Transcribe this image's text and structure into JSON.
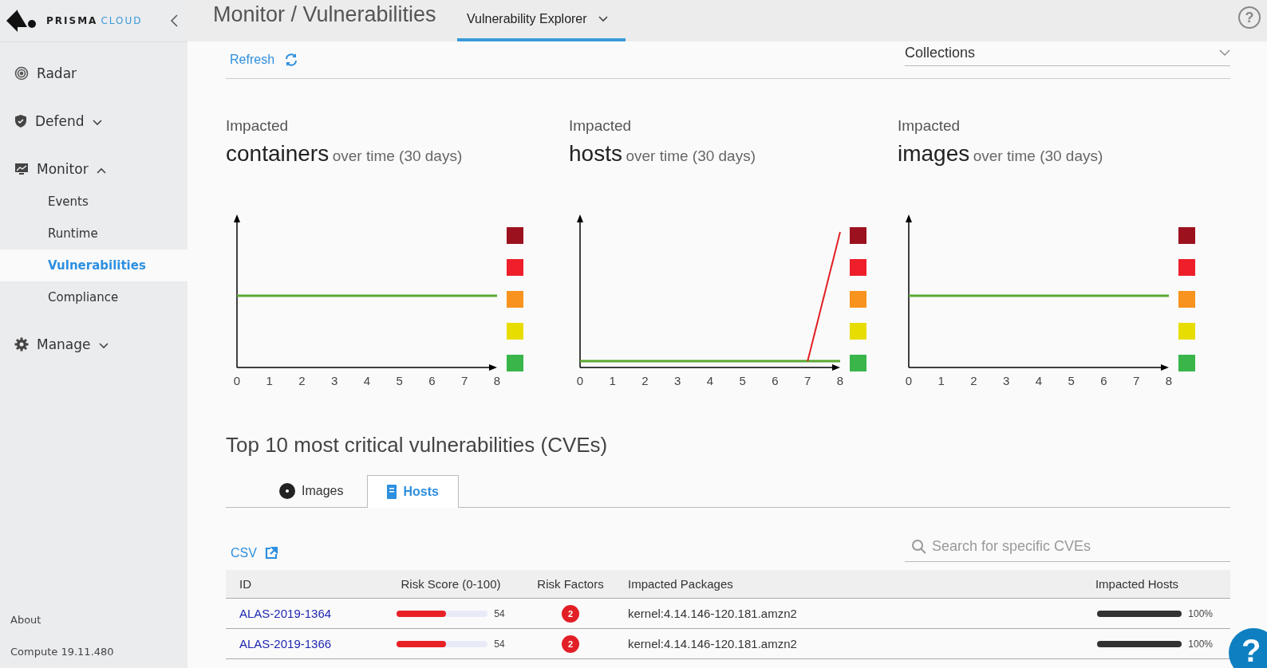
{
  "sidebar": {
    "logo": {
      "brand": "PRISMA",
      "product": "CLOUD"
    },
    "items": [
      {
        "label": "Radar",
        "kind": "radar"
      },
      {
        "label": "Defend",
        "kind": "shield",
        "expanded": false
      },
      {
        "label": "Monitor",
        "kind": "monitor",
        "expanded": true,
        "children": [
          {
            "label": "Events",
            "selected": false
          },
          {
            "label": "Runtime",
            "selected": false
          },
          {
            "label": "Vulnerabilities",
            "selected": true
          },
          {
            "label": "Compliance",
            "selected": false
          }
        ]
      },
      {
        "label": "Manage",
        "kind": "gear",
        "expanded": false
      }
    ],
    "footer": [
      "About",
      "Compute 19.11.480"
    ]
  },
  "header": {
    "title": "Monitor / Vulnerabilities",
    "tabs": [
      {
        "label": "Vulnerability Explorer",
        "selected": true
      }
    ]
  },
  "toolbar": {
    "refresh": "Refresh",
    "collections": {
      "placeholder": "Collections"
    }
  },
  "charts": [
    {
      "caption": "Impacted",
      "subject": "containers",
      "period": "over time (30 days)",
      "x_tick_labels": [
        "0",
        "1",
        "2",
        "3",
        "4",
        "5",
        "6",
        "7",
        "8"
      ]
    },
    {
      "caption": "Impacted",
      "subject": "hosts",
      "period": "over time (30 days)",
      "x_tick_labels": [
        "0",
        "1",
        "2",
        "3",
        "4",
        "5",
        "6",
        "7",
        "8"
      ]
    },
    {
      "caption": "Impacted",
      "subject": "images",
      "period": "over time (30 days)",
      "x_tick_labels": [
        "0",
        "1",
        "2",
        "3",
        "4",
        "5",
        "6",
        "7",
        "8"
      ]
    }
  ],
  "severity_legend": [
    {
      "color": "#9b111e"
    },
    {
      "color": "#ee1f2b"
    },
    {
      "color": "#f7931e"
    },
    {
      "color": "#e8dd00"
    },
    {
      "color": "#39b54a"
    }
  ],
  "cve_section": {
    "title": "Top 10 most critical vulnerabilities (CVEs)",
    "tabs": [
      {
        "label": "Images",
        "kind": "disc",
        "selected": false
      },
      {
        "label": "Hosts",
        "kind": "server",
        "selected": true
      }
    ],
    "csv": "CSV",
    "search": {
      "placeholder": "Search for specific CVEs"
    },
    "columns": [
      "ID",
      "Risk Score (0-100)",
      "Risk Factors",
      "Impacted Packages",
      "Impacted Hosts"
    ],
    "rows": [
      {
        "id": "ALAS-2019-1364",
        "risk": {
          "level": 0.54,
          "reading": "54"
        },
        "factors": "2",
        "package": "kernel:4.14.146-120.181.amzn2",
        "hosts": {
          "level": 1.0,
          "reading": "100%"
        }
      },
      {
        "id": "ALAS-2019-1366",
        "risk": {
          "level": 0.54,
          "reading": "54"
        },
        "factors": "2",
        "package": "kernel:4.14.146-120.181.amzn2",
        "hosts": {
          "level": 1.0,
          "reading": "100%"
        }
      }
    ]
  },
  "help": "?"
}
